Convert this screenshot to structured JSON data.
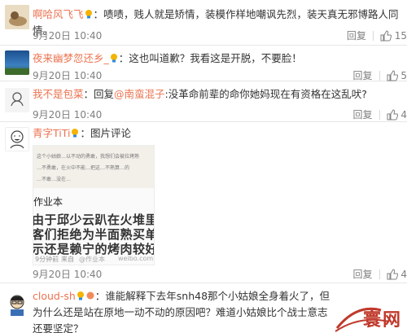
{
  "comments": [
    {
      "username": "啊哈风飞飞",
      "text": "：啧啧，贱人就是矫情，装模作样地嘲讽先烈，装天真无邪博路人同情。",
      "time": "9月20日 10:40",
      "reply_label": "回复",
      "like_count": "15"
    },
    {
      "username": "夜来幽梦忽还乡_",
      "text": "：这也叫道歉？我看这是开脱，不要脸！",
      "time": "9月20日 10:40",
      "reply_label": "回复",
      "like_count": "5"
    },
    {
      "username": "我不是包菜",
      "reply_prefix": "：回复",
      "mention": "@南蛮混子",
      "text": ":没革命前辈的命你她妈现在有资格在这乱吠?",
      "time": "9月20日 10:40",
      "reply_label": "回复",
      "like_count": "4"
    },
    {
      "username": "青字TiTi",
      "text": "：图片评论",
      "time": "9月20日 10:40",
      "reply_label": "回复",
      "like_count": "4",
      "screenshot": {
        "line1": "这个小姑娘…以不动的勇敢，我想们会被拉烤熟",
        "line2": "…不勇敢，在火中不能…把这…不熟算…的",
        "line3": "…不敢…没在…",
        "heading": "作业本",
        "big1": "由于邱少云趴在火堆里一动不",
        "big2": "客们拒绝为半面熟买单，他",
        "big3": "示还是赖宁的烤肉较好。",
        "footer_time": "9分钟前",
        "footer_source": "来自",
        "footer_brand": "weibo.com",
        "footer_label": "@作业本"
      }
    },
    {
      "username": "cloud-sh",
      "text": "：谁能解释下去年snh48那个小姑娘全身着火了，但为什么还是站在原地一动不动的原因吧？难道小姑娘比个战士意志还要坚定？",
      "line2": "原因吧？难道小姑娘比个战士意志还要坚定？"
    }
  ],
  "watermark": "寰网",
  "colors": {
    "username": "#eb7350",
    "text": "#333333",
    "meta": "#808080",
    "divider": "#e6e6e6",
    "watermark": "#c0392b"
  }
}
